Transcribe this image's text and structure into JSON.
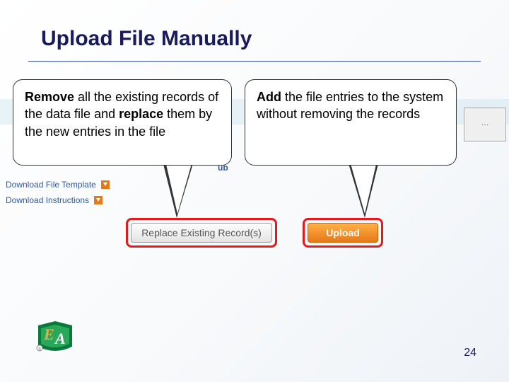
{
  "title": "Upload File Manually",
  "callouts": {
    "left": {
      "bold1": "Remove",
      "mid1": " all the existing records of the data file and ",
      "bold2": "replace",
      "mid2": " them by the new entries in the file"
    },
    "right": {
      "bold1": "Add",
      "rest": " the file entries to the system without removing the records"
    }
  },
  "background_ui": {
    "sub_label": "ub",
    "download_template": "Download File Template",
    "download_instructions": "Download Instructions",
    "browse_hint": "···"
  },
  "buttons": {
    "replace": "Replace Existing Record(s)",
    "upload": "Upload"
  },
  "page_number": "24"
}
